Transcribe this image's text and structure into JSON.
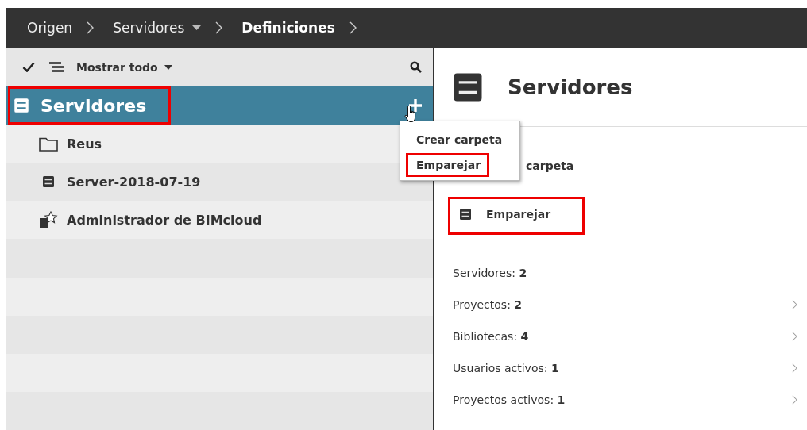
{
  "breadcrumb": [
    {
      "label": "Origen",
      "dropdown": false,
      "current": false
    },
    {
      "label": "Servidores",
      "dropdown": true,
      "current": false
    },
    {
      "label": "Definiciones",
      "dropdown": false,
      "current": true
    }
  ],
  "toolbar": {
    "filter": "Mostrar todo"
  },
  "tree": {
    "root": {
      "label": "Servidores",
      "selected": true,
      "highlighted": true
    },
    "items": [
      {
        "kind": "folder",
        "label": "Reus"
      },
      {
        "kind": "server",
        "label": "Server-2018-07-19"
      },
      {
        "kind": "admin",
        "label": "Administrador de BIMcloud"
      }
    ]
  },
  "menu": [
    {
      "label": "Crear carpeta",
      "highlighted": false
    },
    {
      "label": "Emparejar",
      "highlighted": true
    }
  ],
  "detail": {
    "title": "Servidores",
    "actions": [
      {
        "kind": "text",
        "label": "carpeta",
        "highlighted": false
      },
      {
        "kind": "server",
        "label": "Emparejar",
        "highlighted": true
      }
    ],
    "stats": [
      {
        "text": "Servidores: **2**",
        "link": false
      },
      {
        "text": "Proyectos: **2**",
        "link": true
      },
      {
        "text": "Bibliotecas: **4**",
        "link": true
      },
      {
        "text": "Usuarios activos: **1**",
        "link": true
      },
      {
        "text": "Proyectos activos: **1**",
        "link": true
      }
    ]
  }
}
